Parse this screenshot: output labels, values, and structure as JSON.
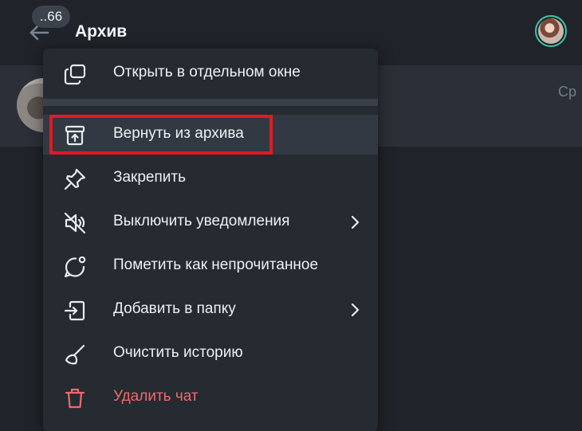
{
  "header": {
    "unread_badge": "..66",
    "title": "Архив",
    "back_icon": "arrow-left-icon",
    "avatar": "user-avatar"
  },
  "chat_row": {
    "time": "Ср"
  },
  "menu": {
    "items": [
      {
        "label": "Открыть в отдельном окне",
        "icon": "new-window-icon"
      },
      {
        "label": "Вернуть из архива",
        "icon": "unarchive-icon"
      },
      {
        "label": "Закрепить",
        "icon": "pin-icon"
      },
      {
        "label": "Выключить уведомления",
        "icon": "mute-icon",
        "has_submenu": true
      },
      {
        "label": "Пометить как непрочитанное",
        "icon": "mark-unread-icon"
      },
      {
        "label": "Добавить в папку",
        "icon": "add-to-folder-icon",
        "has_submenu": true
      },
      {
        "label": "Очистить историю",
        "icon": "broom-icon"
      },
      {
        "label": "Удалить чат",
        "icon": "trash-icon",
        "danger": true
      }
    ]
  },
  "colors": {
    "background": "#202329",
    "menu_background": "#262a31",
    "highlight_border": "#e01b22",
    "danger_text": "#ef6b6b",
    "avatar_ring": "#3bc7a6"
  }
}
